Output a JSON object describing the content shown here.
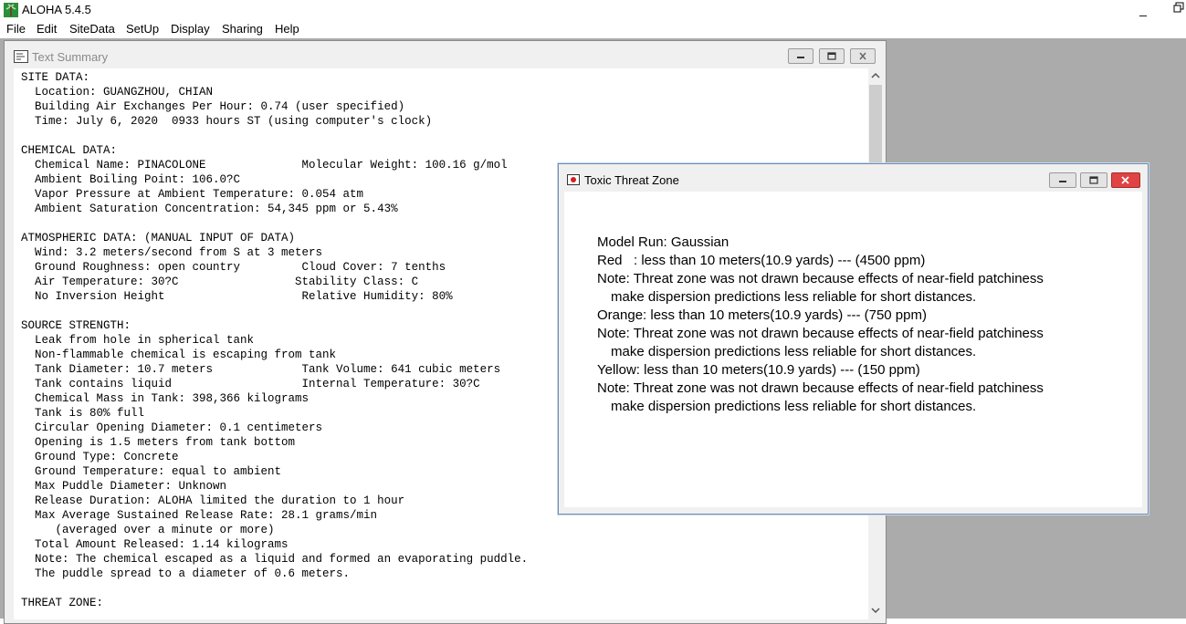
{
  "app": {
    "title": "ALOHA 5.4.5",
    "minimize_glyph": "_"
  },
  "menu": [
    "File",
    "Edit",
    "SiteData",
    "SetUp",
    "Display",
    "Sharing",
    "Help"
  ],
  "text_summary": {
    "title": "Text Summary",
    "lines": [
      "SITE DATA:",
      "  Location: GUANGZHOU, CHIAN",
      "  Building Air Exchanges Per Hour: 0.74 (user specified)",
      "  Time: July 6, 2020  0933 hours ST (using computer's clock)",
      "",
      "CHEMICAL DATA:",
      "  Chemical Name: PINACOLONE              Molecular Weight: 100.16 g/mol",
      "  Ambient Boiling Point: 106.0?C",
      "  Vapor Pressure at Ambient Temperature: 0.054 atm",
      "  Ambient Saturation Concentration: 54,345 ppm or 5.43%",
      "",
      "ATMOSPHERIC DATA: (MANUAL INPUT OF DATA)",
      "  Wind: 3.2 meters/second from S at 3 meters",
      "  Ground Roughness: open country         Cloud Cover: 7 tenths",
      "  Air Temperature: 30?C                 Stability Class: C",
      "  No Inversion Height                    Relative Humidity: 80%",
      "",
      "SOURCE STRENGTH:",
      "  Leak from hole in spherical tank",
      "  Non-flammable chemical is escaping from tank",
      "  Tank Diameter: 10.7 meters             Tank Volume: 641 cubic meters",
      "  Tank contains liquid                   Internal Temperature: 30?C",
      "  Chemical Mass in Tank: 398,366 kilograms",
      "  Tank is 80% full",
      "  Circular Opening Diameter: 0.1 centimeters",
      "  Opening is 1.5 meters from tank bottom",
      "  Ground Type: Concrete",
      "  Ground Temperature: equal to ambient",
      "  Max Puddle Diameter: Unknown",
      "  Release Duration: ALOHA limited the duration to 1 hour",
      "  Max Average Sustained Release Rate: 28.1 grams/min",
      "     (averaged over a minute or more)",
      "  Total Amount Released: 1.14 kilograms",
      "  Note: The chemical escaped as a liquid and formed an evaporating puddle.",
      "  The puddle spread to a diameter of 0.6 meters.",
      "",
      "THREAT ZONE:"
    ]
  },
  "toxic_threat_zone": {
    "title": "Toxic Threat Zone",
    "model_run": "Model Run: Gaussian",
    "red": "Red   : less than 10 meters(10.9 yards) --- (4500 ppm)",
    "note_red_1": "Note: Threat zone was not drawn because effects of near-field patchiness",
    "note_red_2": "make dispersion predictions less reliable for short distances.",
    "orange": "Orange: less than 10 meters(10.9 yards) --- (750 ppm)",
    "note_orange_1": "Note: Threat zone was not drawn because effects of near-field patchiness",
    "note_orange_2": "make dispersion predictions less reliable for short distances.",
    "yellow": "Yellow: less than 10 meters(10.9 yards) --- (150 ppm)",
    "note_yellow_1": "Note: Threat zone was not drawn because effects of near-field patchiness",
    "note_yellow_2": "make dispersion predictions less reliable for short distances."
  },
  "colors": {
    "mdi_background": "#ababab",
    "close_button": "#e04343"
  }
}
